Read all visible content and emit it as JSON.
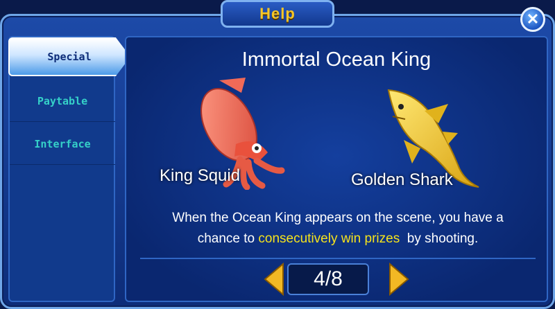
{
  "window": {
    "title": "Help",
    "close_icon": "close-icon"
  },
  "sidebar": {
    "items": [
      {
        "label": "Special",
        "active": true
      },
      {
        "label": "Paytable",
        "active": false
      },
      {
        "label": "Interface",
        "active": false
      }
    ]
  },
  "main": {
    "heading": "Immortal Ocean King",
    "creatures": [
      {
        "label": "King Squid",
        "icon": "squid-icon"
      },
      {
        "label": "Golden Shark",
        "icon": "shark-icon"
      }
    ],
    "description": {
      "line1": "When the Ocean King appears on the scene, you have a",
      "line2_prefix": "chance to ",
      "line2_highlight": "consecutively win prizes",
      "line2_suffix": "  by shooting."
    },
    "pager": {
      "current": 4,
      "total": 8,
      "display": "4/8"
    }
  },
  "colors": {
    "accent": "#f6c627",
    "highlight": "#f5e31c",
    "tab_text": "#35d0c8",
    "background": "#0d2c78"
  }
}
